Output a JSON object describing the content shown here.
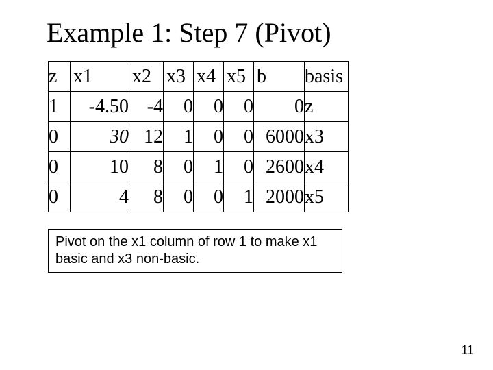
{
  "title": "Example 1: Step 7 (Pivot)",
  "chart_data": {
    "type": "table",
    "headers": [
      "z",
      "x1",
      "x2",
      "x3",
      "x4",
      "x5",
      "b",
      "basis"
    ],
    "rows": [
      {
        "z": "1",
        "x1": "-4.50",
        "x2": "-4",
        "x3": "0",
        "x4": "0",
        "x5": "0",
        "b": "0",
        "basis": "z"
      },
      {
        "z": "0",
        "x1": "30",
        "x2": "12",
        "x3": "1",
        "x4": "0",
        "x5": "0",
        "b": "6000",
        "basis": "x3"
      },
      {
        "z": "0",
        "x1": "10",
        "x2": "8",
        "x3": "0",
        "x4": "1",
        "x5": "0",
        "b": "2600",
        "basis": "x4"
      },
      {
        "z": "0",
        "x1": "4",
        "x2": "8",
        "x3": "0",
        "x4": "0",
        "x5": "1",
        "b": "2000",
        "basis": "x5"
      }
    ],
    "pivot_cell": {
      "row": 1,
      "col": "x1"
    }
  },
  "caption": "Pivot on the x1 column of row 1 to make x1 basic and x3 non-basic.",
  "page_number": "11"
}
